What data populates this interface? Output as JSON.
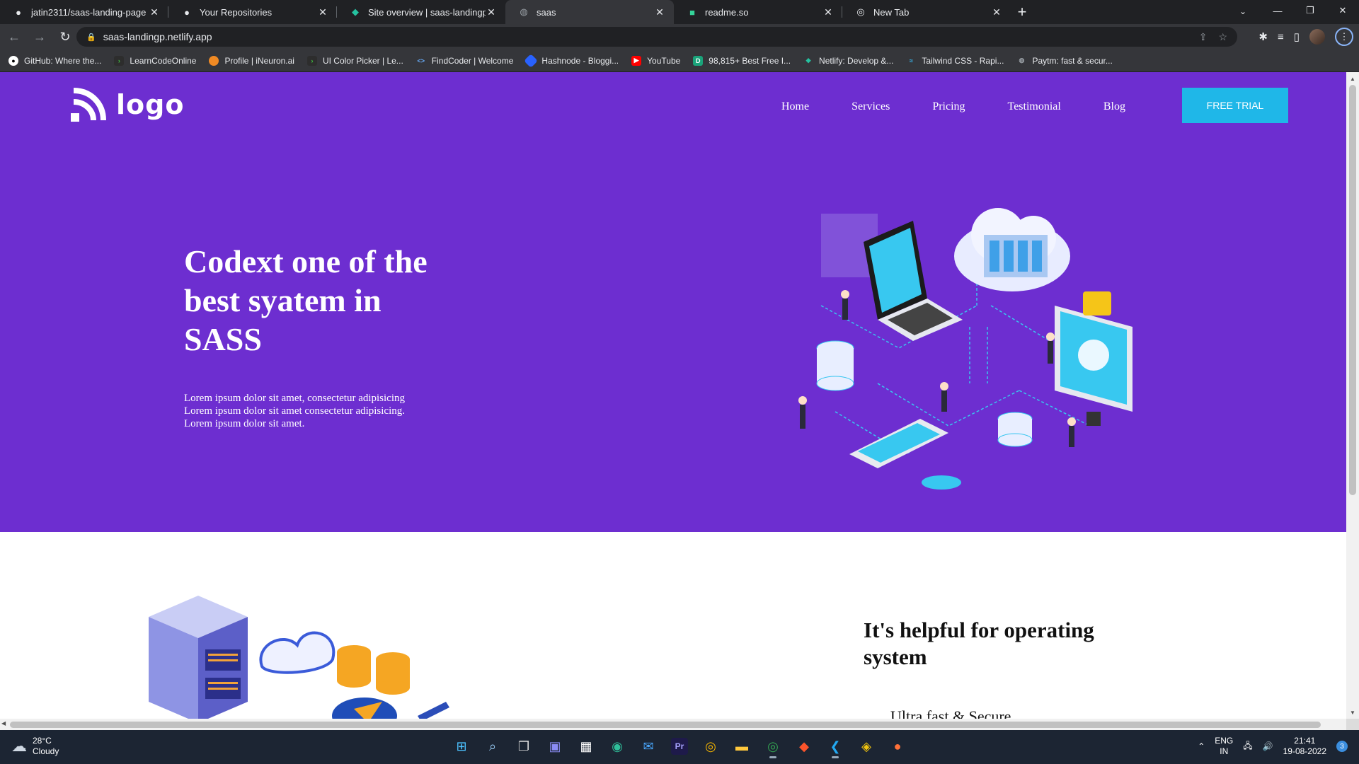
{
  "browser": {
    "tabs": [
      {
        "title": "jatin2311/saas-landing-page",
        "icon": "github-icon"
      },
      {
        "title": "Your Repositories",
        "icon": "github-icon"
      },
      {
        "title": "Site overview | saas-landingp",
        "icon": "netlify-icon"
      },
      {
        "title": "saas",
        "icon": "globe-icon",
        "active": true
      },
      {
        "title": "readme.so",
        "icon": "readme-icon"
      },
      {
        "title": "New Tab",
        "icon": "chrome-icon"
      }
    ],
    "url": "saas-landingp.netlify.app",
    "bookmarks": [
      {
        "label": "GitHub: Where the...",
        "icon": "github-icon"
      },
      {
        "label": "LearnCodeOnline",
        "icon": "lco-icon"
      },
      {
        "label": "Profile | iNeuron.ai",
        "icon": "ineuron-icon"
      },
      {
        "label": "UI Color Picker | Le...",
        "icon": "lco-icon"
      },
      {
        "label": "FindCoder | Welcome",
        "icon": "code-icon"
      },
      {
        "label": "Hashnode - Bloggi...",
        "icon": "hashnode-icon"
      },
      {
        "label": "YouTube",
        "icon": "youtube-icon"
      },
      {
        "label": "98,815+ Best Free I...",
        "icon": "d-icon"
      },
      {
        "label": "Netlify: Develop &...",
        "icon": "netlify-icon"
      },
      {
        "label": "Tailwind CSS - Rapi...",
        "icon": "tailwind-icon"
      },
      {
        "label": "Paytm: fast & secur...",
        "icon": "globe-icon"
      }
    ]
  },
  "page": {
    "logo_text": "logo",
    "nav": [
      "Home",
      "Services",
      "Pricing",
      "Testimonial",
      "Blog"
    ],
    "cta": "FREE TRIAL",
    "hero": {
      "headline": "Codext one of the best syatem in SASS",
      "body": "Lorem ipsum dolor sit amet, consectetur adipisicing Lorem ipsum dolor sit amet consectetur adipisicing. Lorem ipsum dolor sit amet."
    },
    "section2": {
      "title": "It's helpful for operating system",
      "feature": "Ultra fast & Secure"
    },
    "colors": {
      "hero_bg": "#6d2ed0",
      "cta_bg": "#1fb7e8"
    }
  },
  "taskbar": {
    "weather": {
      "temp": "28°C",
      "condition": "Cloudy"
    },
    "lang": {
      "line1": "ENG",
      "line2": "IN"
    },
    "clock": {
      "time": "21:41",
      "date": "19-08-2022"
    },
    "notifications": "3",
    "apps": [
      "windows-start-icon",
      "search-icon",
      "task-view-icon",
      "teams-chat-icon",
      "store-icon",
      "edge-icon",
      "mail-icon",
      "premiere-icon",
      "chrome-icon",
      "file-explorer-icon",
      "chrome-profile-icon",
      "brave-icon",
      "vscode-icon",
      "git-icon",
      "firefox-icon"
    ]
  }
}
